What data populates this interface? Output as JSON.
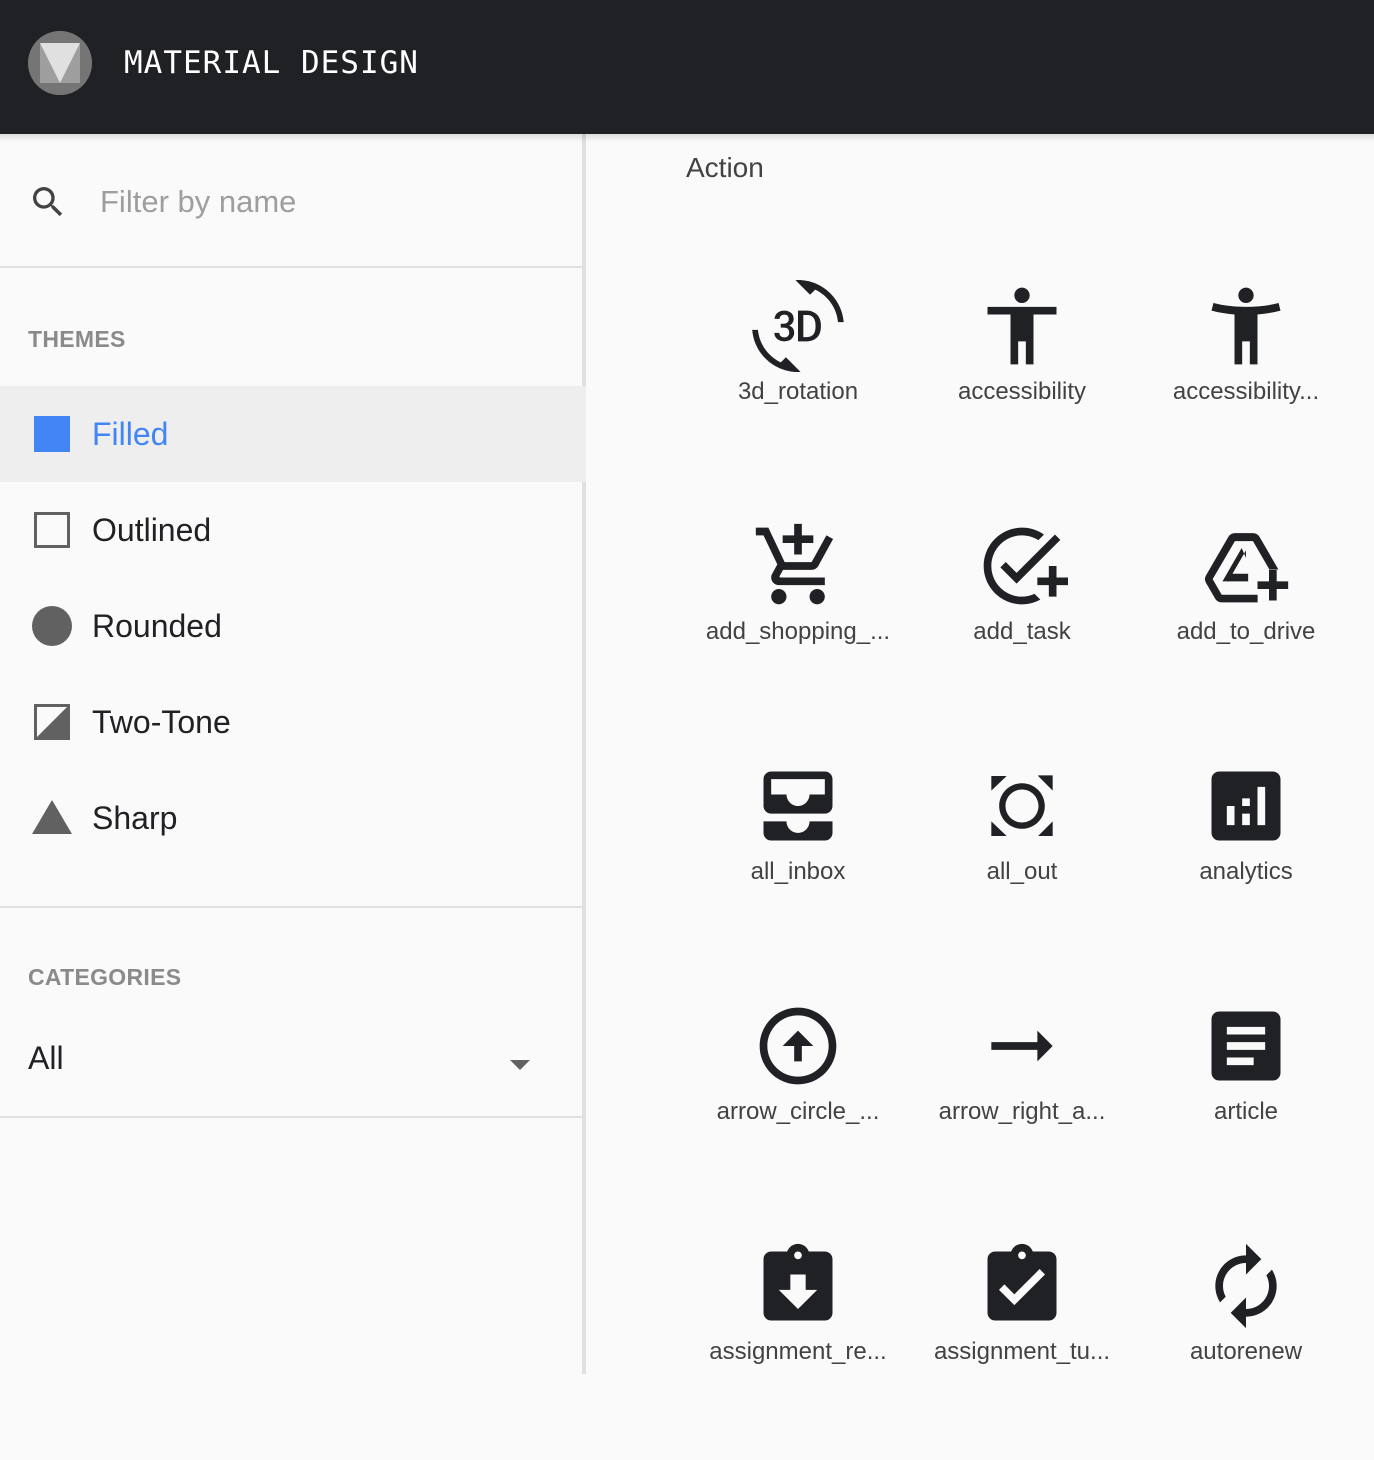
{
  "app": {
    "brand": "MATERIAL DESIGN"
  },
  "search": {
    "placeholder": "Filter by name",
    "value": ""
  },
  "themes": {
    "heading": "THEMES",
    "items": [
      {
        "label": "Filled",
        "icon": "filled-square-icon",
        "selected": true
      },
      {
        "label": "Outlined",
        "icon": "outlined-square-icon",
        "selected": false
      },
      {
        "label": "Rounded",
        "icon": "circle-icon",
        "selected": false
      },
      {
        "label": "Two-Tone",
        "icon": "two-tone-square-icon",
        "selected": false
      },
      {
        "label": "Sharp",
        "icon": "triangle-icon",
        "selected": false
      }
    ]
  },
  "categories": {
    "heading": "CATEGORIES",
    "selected": "All"
  },
  "main": {
    "group_title": "Action",
    "icons": [
      {
        "label": "3d_rotation"
      },
      {
        "label": "accessibility"
      },
      {
        "label": "accessibility..."
      },
      {
        "label": "add_shopping_..."
      },
      {
        "label": "add_task"
      },
      {
        "label": "add_to_drive"
      },
      {
        "label": "all_inbox"
      },
      {
        "label": "all_out"
      },
      {
        "label": "analytics"
      },
      {
        "label": "arrow_circle_..."
      },
      {
        "label": "arrow_right_a..."
      },
      {
        "label": "article"
      },
      {
        "label": "assignment_re..."
      },
      {
        "label": "assignment_tu..."
      },
      {
        "label": "autorenew"
      }
    ]
  },
  "colors": {
    "accent": "#4285f4",
    "topbar": "#202124",
    "icon": "#202124",
    "muted": "#8a8a8a"
  }
}
